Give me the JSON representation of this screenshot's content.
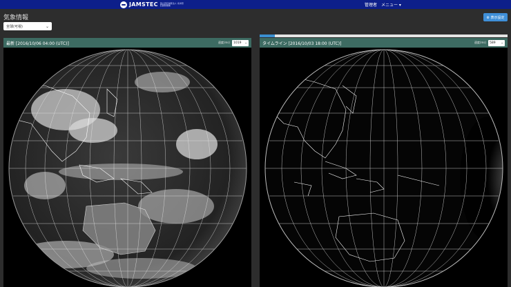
{
  "header": {
    "brand": "JAMSTEC",
    "brand_sub": "国立研究開発法人 海洋研究開発機構",
    "nav_admin": "管理者",
    "nav_menu": "メニュー ▾"
  },
  "page": {
    "title": "気象情報",
    "region_select_value": "全球(可視)",
    "settings_button": "⚙ 表示設定"
  },
  "timeline": {
    "progress": 0.06
  },
  "left_panel": {
    "title": "最新 [2016/10/06 04:00 (UTC)]",
    "speed_label": "速度(ms)",
    "speed_value": "1019"
  },
  "right_panel": {
    "title": "タイムライン [2016/10/03 18:00 (UTC)]",
    "speed_label": "速度(ms)",
    "speed_value": "589"
  },
  "colors": {
    "topbar": "#0d1f8a",
    "panel_header": "#3d6b62",
    "button_blue": "#3f8fd8",
    "background": "#2d2d2d"
  }
}
